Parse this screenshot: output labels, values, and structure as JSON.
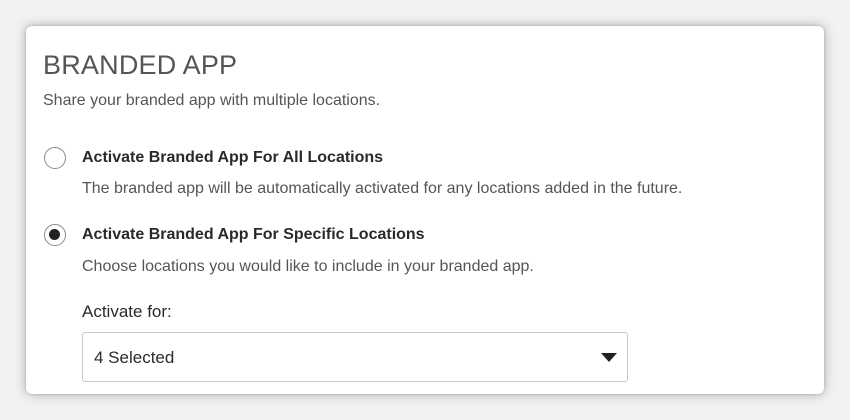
{
  "section": {
    "title": "BRANDED APP",
    "subtitle": "Share your branded app with multiple locations."
  },
  "options": [
    {
      "label": "Activate Branded App For All Locations",
      "description": "The branded app will be automatically activated for any locations added in the future.",
      "selected": false
    },
    {
      "label": "Activate Branded App For Specific Locations",
      "description": "Choose locations you would like to include in your branded app.",
      "selected": true
    }
  ],
  "activate_for": {
    "label": "Activate for:",
    "selected_value": "4 Selected",
    "caret_icon": "caret-down-icon"
  },
  "colors": {
    "text_dark": "#2a2a2a",
    "text_muted": "#555555",
    "radio_selected": "#222222",
    "border": "#c9c9c9"
  }
}
